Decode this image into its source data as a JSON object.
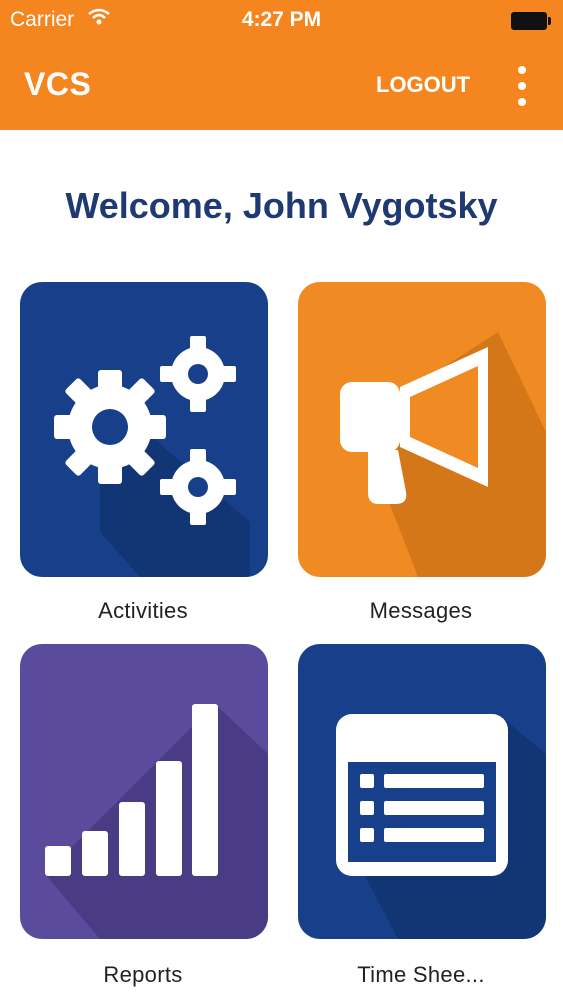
{
  "status_bar": {
    "carrier": "Carrier",
    "time": "4:27 PM"
  },
  "header": {
    "title": "VCS",
    "logout_label": "LOGOUT"
  },
  "welcome": {
    "text": "Welcome, John Vygotsky"
  },
  "tiles": [
    {
      "label": "Activities",
      "icon": "gears-icon",
      "color": "#173f8a"
    },
    {
      "label": "Messages",
      "icon": "megaphone-icon",
      "color": "#f08a22"
    },
    {
      "label": "Reports",
      "icon": "bar-chart-icon",
      "color": "#5b4b9c"
    },
    {
      "label": "Time Shee...",
      "icon": "calendar-list-icon",
      "color": "#173f8a"
    }
  ],
  "colors": {
    "accent": "#f5861f",
    "welcome_text": "#1f3a73"
  }
}
